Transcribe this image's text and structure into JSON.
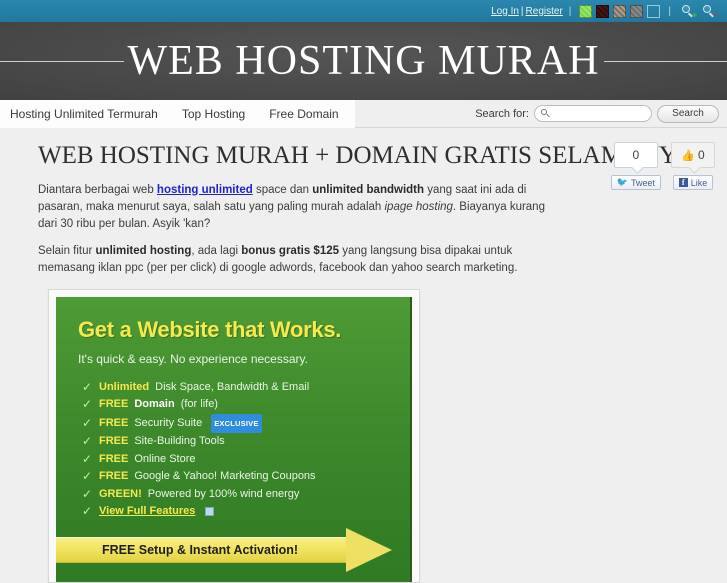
{
  "topbar": {
    "login_label": "Log In",
    "divider": "|",
    "register_label": "Register",
    "sep1": "|",
    "sep2": "|",
    "swatches": [
      {
        "name": "swatch-green",
        "color": "#8de05a"
      },
      {
        "name": "swatch-dark-red",
        "color": "#3b1212"
      },
      {
        "name": "swatch-blue-orange",
        "color": "#c98a3c"
      },
      {
        "name": "swatch-gray",
        "color": "#7d7d7d"
      },
      {
        "name": "swatch-empty",
        "color": "#2a7fa3"
      }
    ],
    "zoom_in_icon": "magnifier-plus-icon",
    "zoom_out_icon": "magnifier-minus-icon"
  },
  "header": {
    "site_title": "WEB HOSTING MURAH"
  },
  "nav": {
    "items": [
      {
        "label": "Hosting Unlimited Termurah"
      },
      {
        "label": "Top Hosting"
      },
      {
        "label": "Free Domain"
      }
    ]
  },
  "search": {
    "label": "Search for:",
    "value": "",
    "placeholder": "",
    "button_label": "Search"
  },
  "page": {
    "title": "WEB HOSTING MURAH + DOMAIN GRATIS SELAMANYA",
    "paragraph1": {
      "t1": "Diantara berbagai web ",
      "link": "hosting unlimited",
      "t2": " space dan ",
      "b1": "unlimited bandwidth",
      "t3": " yang saat ini ada di pasaran, maka menurut saya, salah satu yang paling murah adalah ",
      "i1": "ipage hosting",
      "t4": ". Biayanya kurang dari 30 ribu per bulan. Asyik 'kan?"
    },
    "paragraph2": {
      "t1": "Selain fitur ",
      "b1": "unlimited hosting",
      "t2": ", ada lagi ",
      "b2": "bonus gratis $125",
      "t3": " yang langsung bisa dipakai untuk memasang iklan ppc (per per click) di google adwords, facebook dan yahoo search marketing."
    }
  },
  "share": {
    "tweet_count": "0",
    "tweet_label": "Tweet",
    "like_count": "0",
    "like_label": "Like",
    "thumb_icon": "thumbs-up-icon",
    "twitter_icon": "twitter-bird-icon",
    "facebook_icon": "facebook-f-icon"
  },
  "ad": {
    "headline": "Get a Website that Works.",
    "subhead": "It's quick & easy. No experience necessary.",
    "check_icon": "check-icon",
    "features": [
      {
        "hi": "Unlimited",
        "rest": " Disk Space, Bandwidth & Email"
      },
      {
        "hi": "FREE",
        "wh": " Domain",
        "rest": " (for life)"
      },
      {
        "hi": "FREE",
        "rest": " Security Suite",
        "badge": "EXCLUSIVE"
      },
      {
        "hi": "FREE",
        "rest": " Site-Building Tools"
      },
      {
        "hi": "FREE",
        "rest": " Online Store"
      },
      {
        "hi": "FREE",
        "rest": " Google & Yahoo! Marketing Coupons"
      },
      {
        "hi": "GREEN!",
        "rest": " Powered by 100% wind energy"
      },
      {
        "link": "View Full Features",
        "icon": "window-icon"
      }
    ],
    "cta": "FREE Setup & Instant Activation!"
  },
  "colors": {
    "topbar": "#2680a6",
    "header": "#4a4a4a",
    "ad_green": "#3f8a2c",
    "ad_yellow": "#f6e94e",
    "link_blue": "#2222cc",
    "badge_blue": "#2e8ddd"
  }
}
